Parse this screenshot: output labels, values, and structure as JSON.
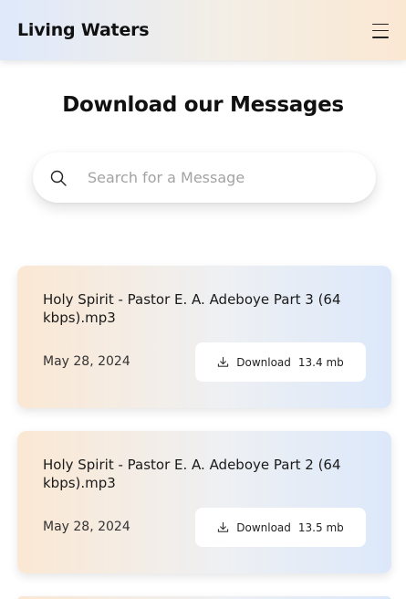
{
  "header": {
    "brand": "Living Waters",
    "menu_icon": "hamburger-menu-icon"
  },
  "main": {
    "title": "Download our Messages",
    "search": {
      "placeholder": "Search for a Message",
      "value": "",
      "icon": "search-icon"
    },
    "messages": [
      {
        "title": "Holy Spirit - Pastor E. A. Adeboye Part 3 (64 kbps).mp3",
        "date": "May 28, 2024",
        "download_label": "Download",
        "size": "13.4 mb"
      },
      {
        "title": "Holy Spirit - Pastor E. A. Adeboye Part 2 (64 kbps).mp3",
        "date": "May 28, 2024",
        "download_label": "Download",
        "size": "13.5 mb"
      }
    ]
  },
  "colors": {
    "card_gradient_start": "#fbe8d3",
    "card_gradient_end": "#dce8fa",
    "header_gradient_start": "#dfe9fb",
    "header_gradient_end": "#fbe8d3"
  }
}
